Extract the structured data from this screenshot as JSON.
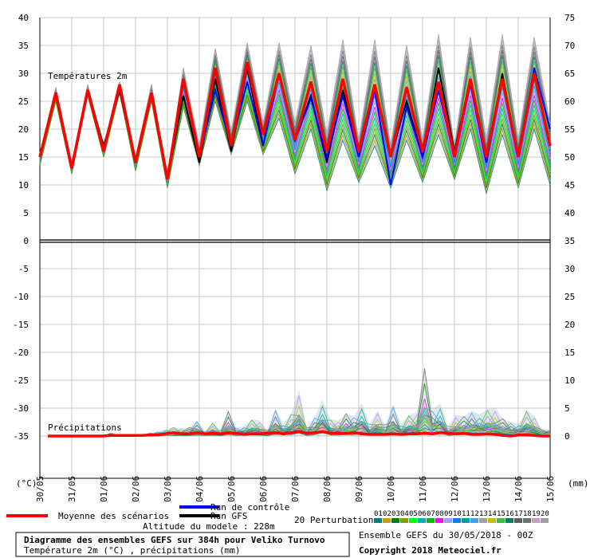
{
  "chart_data": {
    "type": "line",
    "title": "Diagramme des ensembles GEFS sur 384h pour Veliko Turnovo",
    "subtitle": "Température 2m (°C) , précipitations (mm)",
    "section_temp_label": "Températures 2m",
    "section_precip_label": "Précipitations",
    "left_unit": "(°C)",
    "right_unit": "(mm)",
    "altitude": "Altitude du modele : 228m",
    "run_info": "Ensemble GEFS du 30/05/2018 - 00Z",
    "copyright": "Copyright 2018 Meteociel.fr",
    "left_axis": {
      "ylim": [
        -40,
        40
      ],
      "ticks": [
        40,
        35,
        30,
        25,
        20,
        15,
        10,
        5,
        0,
        -5,
        -10,
        -15,
        -20,
        -25,
        -30,
        -35
      ]
    },
    "right_axis": {
      "ticks": [
        75,
        70,
        65,
        60,
        55,
        50,
        45,
        40,
        35,
        30,
        25,
        20,
        15,
        10,
        5,
        0
      ]
    },
    "x_dates": [
      "30/05",
      "31/05",
      "01/06",
      "02/06",
      "03/06",
      "04/06",
      "05/06",
      "06/06",
      "07/06",
      "08/06",
      "09/06",
      "10/06",
      "11/06",
      "12/06",
      "13/06",
      "14/06",
      "15/06"
    ],
    "legend": {
      "mean": "Moyenne des scénarios",
      "control": "Run de contrôle",
      "gfs": "Run GFS",
      "perturbations": "20 Perturbations",
      "pert_numbers": [
        "01",
        "02",
        "03",
        "04",
        "05",
        "06",
        "07",
        "08",
        "09",
        "10",
        "11",
        "12",
        "13",
        "14",
        "15",
        "16",
        "17",
        "18",
        "19",
        "20"
      ]
    },
    "colors": {
      "mean": "#ff0000",
      "control": "#0000ff",
      "gfs": "#000000",
      "grid": "#c8c8c8",
      "zero_line": "#000000",
      "perturbations": [
        "#008080",
        "#c8a000",
        "#008000",
        "#80a000",
        "#00ff00",
        "#00b0b0",
        "#00c000",
        "#ff00ff",
        "#a0a0ff",
        "#0080ff",
        "#00a0a0",
        "#40a0ff",
        "#a0a0a0",
        "#c0c000",
        "#40c040",
        "#008060",
        "#606060",
        "#707070",
        "#c0a0c0",
        "#a0a0a0"
      ]
    },
    "temperature_series": {
      "mean": [
        15,
        26.5,
        13,
        27,
        16,
        28,
        14,
        26.5,
        11,
        29,
        15,
        31,
        17,
        32,
        19,
        30,
        18,
        28.5,
        16,
        29,
        16,
        28,
        15,
        27.5,
        16,
        28.5,
        15,
        29,
        15,
        29,
        15,
        30,
        17
      ],
      "control": [
        15,
        26.5,
        13,
        27,
        16,
        27.5,
        14,
        26.5,
        11,
        28.5,
        15,
        27,
        17,
        28.5,
        17,
        30,
        18,
        25.5,
        15,
        26,
        15,
        27,
        10,
        24,
        15,
        27,
        15,
        28,
        14,
        29,
        15,
        31,
        20
      ],
      "gfs": [
        15,
        26.5,
        13,
        27,
        17,
        27,
        14,
        26,
        11,
        26,
        14,
        29,
        16,
        31,
        17,
        30,
        18,
        26,
        14,
        27,
        16,
        28,
        15,
        25,
        15,
        31,
        16,
        29,
        14,
        30,
        15,
        30,
        17
      ]
    },
    "temperature_spread": {
      "min": [
        13.5,
        25,
        12,
        26,
        15,
        26.5,
        12.5,
        25,
        9.5,
        24,
        13.5,
        25,
        15.5,
        25,
        15.5,
        22,
        12,
        20,
        9,
        18,
        10.5,
        17,
        9.5,
        18,
        10.5,
        19,
        11,
        20,
        8.5,
        19,
        9.5,
        20,
        10
      ],
      "max": [
        15.5,
        27.5,
        14,
        28,
        17,
        28.5,
        15,
        28,
        11.5,
        31,
        17,
        34.5,
        19.5,
        35.5,
        21,
        35.5,
        21,
        35,
        19,
        36,
        18,
        36,
        17,
        35,
        18,
        37,
        17,
        36.5,
        18,
        37,
        18,
        36.5,
        21
      ]
    },
    "precip_series": {
      "mean": [
        0,
        0,
        0,
        0,
        0,
        0,
        0,
        0,
        0.1,
        0.1,
        0.1,
        0.1,
        0.1,
        0.2,
        0.2,
        0.4,
        0.6,
        0.4,
        0.4,
        0.6,
        0.4,
        0.5,
        0.4,
        0.6,
        0.5,
        0.3,
        0.4,
        0.4,
        0.5,
        0.6,
        0.4,
        0.6,
        0.8,
        0.5,
        0.6,
        0.8,
        0.5,
        0.5,
        0.5,
        0.6,
        0.4,
        0.3,
        0.3,
        0.3,
        0.4,
        0.3,
        0.4,
        0.4,
        0.5,
        0.4,
        0.6,
        0.5,
        0.4,
        0.5,
        0.3,
        0.3,
        0.4,
        0.3,
        0.1,
        0,
        0.2,
        0.2,
        0.1,
        0,
        0
      ],
      "max": [
        0,
        0,
        0,
        0,
        0,
        0,
        0,
        0,
        0.5,
        0.3,
        0.2,
        0.3,
        0.3,
        0.5,
        0.8,
        1.2,
        1.6,
        1.4,
        1.5,
        2.8,
        0.9,
        2.4,
        1.2,
        4.4,
        1.5,
        1.8,
        3.0,
        2.8,
        1.0,
        5.0,
        2.2,
        4.0,
        8.4,
        1.5,
        3.5,
        6.5,
        3.0,
        2.8,
        4.0,
        3.6,
        5.9,
        2.2,
        4.6,
        2.0,
        5.7,
        2.1,
        3.8,
        4.3,
        12.1,
        4.8,
        5.9,
        1.8,
        3.8,
        3.5,
        4.5,
        3.9,
        4.8,
        5.1,
        3.1,
        2.5,
        2.2,
        4.6,
        3.7,
        1.1,
        1.2
      ]
    }
  }
}
